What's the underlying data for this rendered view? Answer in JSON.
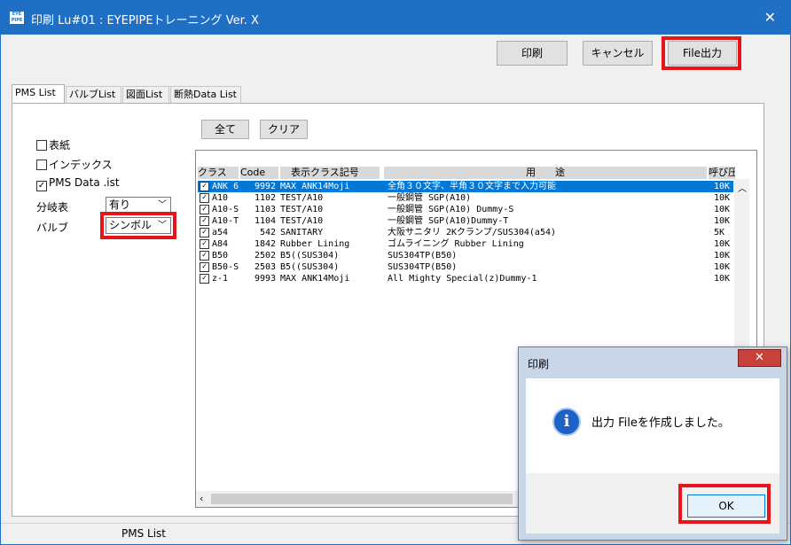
{
  "window": {
    "icon_text": "EYE PIPE",
    "title": "印刷 Lu#01 : EYEPIPEトレーニング  Ver. X",
    "close_symbol": "✕"
  },
  "toolbar": {
    "print_label": "印刷",
    "cancel_label": "キャンセル",
    "file_output_label": "File出力"
  },
  "tabs": [
    "PMS List",
    "バルブList",
    "図面List",
    "断熱Data List"
  ],
  "options": {
    "cover_label": "表紙",
    "cover_checked": false,
    "index_label": "インデックス",
    "index_checked": false,
    "pms_data_list_label": "PMS Data .ist",
    "pms_data_list_checked": true,
    "branch_label": "分岐表",
    "branch_value": "有り",
    "valve_label": "バルブ",
    "valve_value": "シンボル"
  },
  "list_buttons": {
    "all_label": "全て",
    "clear_label": "クリア"
  },
  "table": {
    "columns": [
      "クラス",
      "Code",
      "表示クラス記号",
      "用　　途",
      "呼び圧"
    ],
    "rows": [
      {
        "checked": true,
        "class": "ANK 6",
        "code": "9992",
        "symbol": "MAX ANK14Moji",
        "usage": "全角３０文字、半角３０文字まで入力可能",
        "pressure": "10K",
        "selected": true
      },
      {
        "checked": true,
        "class": "A10",
        "code": "1102",
        "symbol": "TEST/A10",
        "usage": "一般鋼管 SGP(A10)",
        "pressure": "10K",
        "selected": false
      },
      {
        "checked": true,
        "class": "A10-S",
        "code": "1103",
        "symbol": "TEST/A10",
        "usage": "一般鋼管 SGP(A10) Dummy-S",
        "pressure": "10K",
        "selected": false
      },
      {
        "checked": true,
        "class": "A10-T",
        "code": "1104",
        "symbol": "TEST/A10",
        "usage": "一般鋼管 SGP(A10)Dummy-T",
        "pressure": "10K",
        "selected": false
      },
      {
        "checked": true,
        "class": "a54",
        "code": "542",
        "symbol": "SANITARY",
        "usage": "大阪サニタリ 2Kクランプ/SUS304(a54)",
        "pressure": "5K",
        "selected": false
      },
      {
        "checked": true,
        "class": "A84",
        "code": "1842",
        "symbol": "Rubber Lining",
        "usage": "ゴムライニング Rubber Lining",
        "pressure": "10K",
        "selected": false
      },
      {
        "checked": true,
        "class": "B50",
        "code": "2502",
        "symbol": "B5((SUS304)",
        "usage": "SUS304TP(B50)",
        "pressure": "10K",
        "selected": false
      },
      {
        "checked": true,
        "class": "B50-S",
        "code": "2503",
        "symbol": "B5((SUS304)",
        "usage": "SUS304TP(B50)",
        "pressure": "10K",
        "selected": false
      },
      {
        "checked": true,
        "class": "z-1",
        "code": "9993",
        "symbol": "MAX ANK14Moji",
        "usage": "All Mighty Special(z)Dummy-1",
        "pressure": "10K",
        "selected": false
      }
    ]
  },
  "statusbar": {
    "text": "PMS List"
  },
  "dialog": {
    "title": "印刷",
    "close_symbol": "✕",
    "icon_glyph": "i",
    "message": "出力 Fileを作成しました。",
    "ok_label": "OK"
  },
  "colors": {
    "titlebar": "#1f6fc5",
    "highlight_box": "#e8141c",
    "selected_row": "#0078d7"
  }
}
